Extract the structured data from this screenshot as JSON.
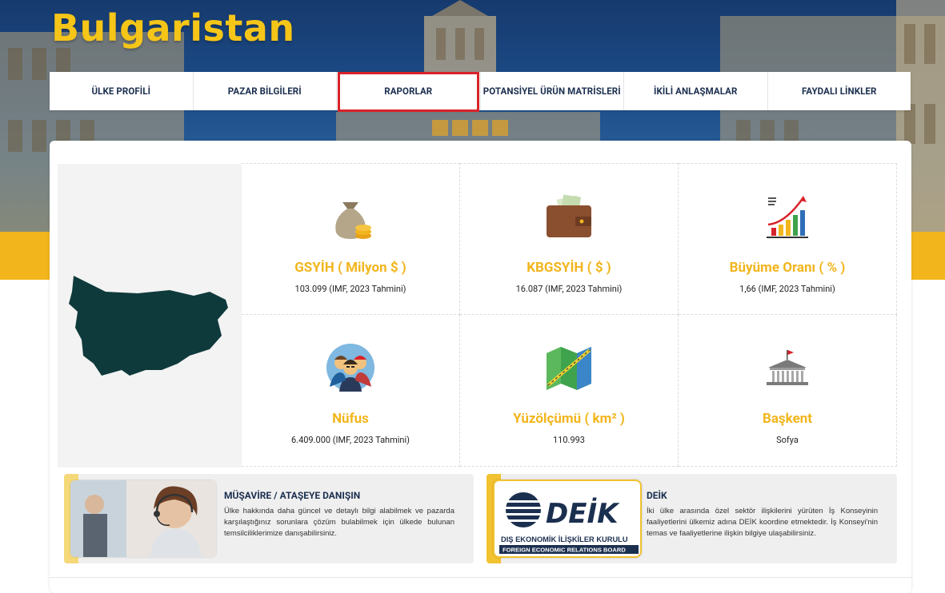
{
  "header": {
    "country_title": "Bulgaristan"
  },
  "nav": {
    "items": [
      {
        "label": "ÜLKE PROFİLİ"
      },
      {
        "label": "PAZAR BİLGİLERİ"
      },
      {
        "label": "RAPORLAR"
      },
      {
        "label": "POTANSİYEL ÜRÜN MATRİSLERİ"
      },
      {
        "label": "İKİLİ ANLAŞMALAR"
      },
      {
        "label": "FAYDALI LİNKLER"
      }
    ],
    "active_index": 2
  },
  "stats": [
    {
      "icon": "money-bag-icon",
      "label": "GSYİH ( Milyon $ )",
      "value": "103.099 (IMF, 2023 Tahmini)"
    },
    {
      "icon": "wallet-icon",
      "label": "KBGSYİH ( $ )",
      "value": "16.087 (IMF, 2023 Tahmini)"
    },
    {
      "icon": "growth-chart-icon",
      "label": "Büyüme Oranı ( % )",
      "value": "1,66 (IMF, 2023 Tahmini)"
    },
    {
      "icon": "population-icon",
      "label": "Nüfus",
      "value": "6.409.000 (IMF, 2023 Tahmini)"
    },
    {
      "icon": "map-icon",
      "label": "Yüzölçümü ( km² )",
      "value": "110.993"
    },
    {
      "icon": "capitol-icon",
      "label": "Başkent",
      "value": "Sofya"
    }
  ],
  "info_left": {
    "title": "MÜŞAVİRE / ATAŞEYE DANIŞIN",
    "description": "Ülke hakkında daha güncel ve detaylı bilgi alabilmek ve pazarda karşılaştığınız sorunlara çözüm bulabilmek için ülkede bulunan temsilciliklerimize danışabilirsiniz."
  },
  "info_right": {
    "title": "DEİK",
    "logo_text": "DEİK",
    "logo_line1": "DIŞ EKONOMİK İLİŞKİLER KURULU",
    "logo_line2": "FOREIGN ECONOMIC RELATIONS BOARD",
    "description": "İki ülke arasında özel sektör ilişkilerini yürüten İş Konseyinin faaliyetlerini ülkemiz adına DEİK koordine etmektedir. İş Konseyi'nin temas ve faaliyetlerine ilişkin bilgiye ulaşabilirsiniz."
  },
  "colors": {
    "accent_yellow": "#f2b51c",
    "nav_text": "#1b2f4f",
    "active_outline": "#d8232a",
    "map_fill": "#0f3a3c"
  }
}
